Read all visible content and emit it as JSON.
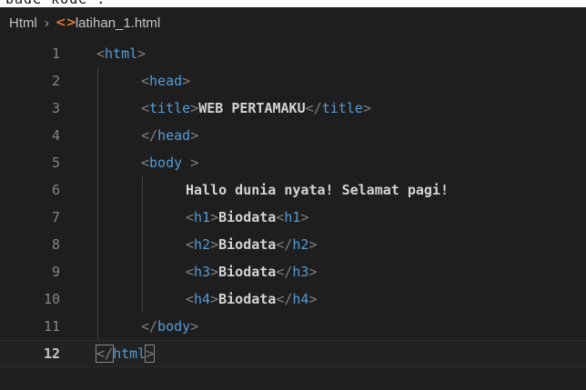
{
  "top_partial_text": "bade kode :",
  "breadcrumb": {
    "root": "Html",
    "file": "latihan_1.html",
    "file_icon": "html-file-icon"
  },
  "lines": [
    {
      "n": "1",
      "indent": 0,
      "parts": [
        [
          "punc",
          "<"
        ],
        [
          "tag",
          "html"
        ],
        [
          "punc",
          ">"
        ]
      ]
    },
    {
      "n": "2",
      "indent": 1,
      "parts": [
        [
          "punc",
          "<"
        ],
        [
          "tag",
          "head"
        ],
        [
          "punc",
          ">"
        ]
      ]
    },
    {
      "n": "3",
      "indent": 1,
      "parts": [
        [
          "punc",
          "<"
        ],
        [
          "tag",
          "title"
        ],
        [
          "punc",
          ">"
        ],
        [
          "txt",
          "WEB PERTAMAKU"
        ],
        [
          "punc",
          "</"
        ],
        [
          "tag",
          "title"
        ],
        [
          "punc",
          ">"
        ]
      ]
    },
    {
      "n": "4",
      "indent": 1,
      "parts": [
        [
          "punc",
          "</"
        ],
        [
          "tag",
          "head"
        ],
        [
          "punc",
          ">"
        ]
      ]
    },
    {
      "n": "5",
      "indent": 1,
      "parts": [
        [
          "punc",
          "<"
        ],
        [
          "tag",
          "body"
        ],
        [
          "txt",
          " "
        ],
        [
          "punc",
          ">"
        ]
      ]
    },
    {
      "n": "6",
      "indent": 2,
      "parts": [
        [
          "txt",
          "Hallo dunia nyata! Selamat pagi!"
        ]
      ]
    },
    {
      "n": "7",
      "indent": 2,
      "parts": [
        [
          "punc",
          "<"
        ],
        [
          "tag",
          "h1"
        ],
        [
          "punc",
          ">"
        ],
        [
          "txt",
          "Biodata"
        ],
        [
          "punc",
          "<"
        ],
        [
          "tag",
          "h1"
        ],
        [
          "punc",
          ">"
        ]
      ]
    },
    {
      "n": "8",
      "indent": 2,
      "parts": [
        [
          "punc",
          "<"
        ],
        [
          "tag",
          "h2"
        ],
        [
          "punc",
          ">"
        ],
        [
          "txt",
          "Biodata"
        ],
        [
          "punc",
          "</"
        ],
        [
          "tag",
          "h2"
        ],
        [
          "punc",
          ">"
        ]
      ]
    },
    {
      "n": "9",
      "indent": 2,
      "parts": [
        [
          "punc",
          "<"
        ],
        [
          "tag",
          "h3"
        ],
        [
          "punc",
          ">"
        ],
        [
          "txt",
          "Biodata"
        ],
        [
          "punc",
          "</"
        ],
        [
          "tag",
          "h3"
        ],
        [
          "punc",
          ">"
        ]
      ]
    },
    {
      "n": "10",
      "indent": 2,
      "parts": [
        [
          "punc",
          "<"
        ],
        [
          "tag",
          "h4"
        ],
        [
          "punc",
          ">"
        ],
        [
          "txt",
          "Biodata"
        ],
        [
          "punc",
          "</"
        ],
        [
          "tag",
          "h4"
        ],
        [
          "punc",
          ">"
        ]
      ]
    },
    {
      "n": "11",
      "indent": 1,
      "parts": [
        [
          "punc",
          "</"
        ],
        [
          "tag",
          "body"
        ],
        [
          "punc",
          ">"
        ]
      ]
    },
    {
      "n": "12",
      "indent": 0,
      "current": true,
      "parts": [
        [
          "punc",
          "</"
        ],
        [
          "tag",
          "html"
        ],
        [
          "punc",
          ">"
        ]
      ]
    }
  ],
  "colors": {
    "background": "#1e1e1e",
    "tag": "#569cd6",
    "punctuation": "#808080",
    "text": "#d4d4d4",
    "line_number": "#858585",
    "html_icon": "#e37933"
  }
}
